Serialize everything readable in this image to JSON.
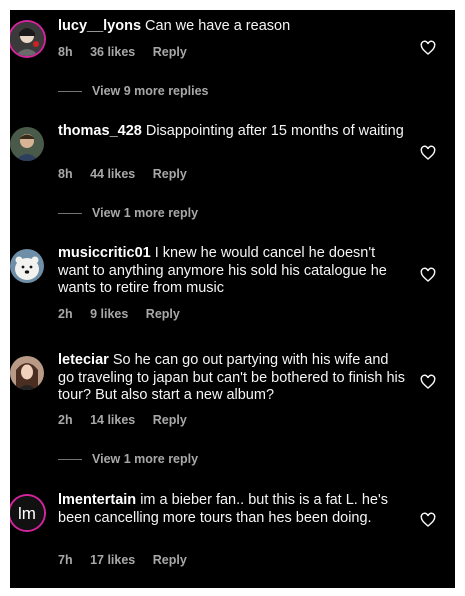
{
  "comments": [
    {
      "username": "lucy__lyons",
      "text": "Can we have a reason",
      "time": "8h",
      "likes": "36 likes",
      "reply": "Reply",
      "avatar": "avatar-photo"
    },
    {
      "username": "thomas_428",
      "text": "Disappointing after 15 months of waiting",
      "time": "8h",
      "likes": "44 likes",
      "reply": "Reply",
      "avatar": "avatar-photo"
    },
    {
      "username": "musiccritic01",
      "text": "I knew he would cancel he doesn't want to anything anymore his sold his catalogue he wants to retire from music",
      "time": "2h",
      "likes": "9 likes",
      "reply": "Reply",
      "avatar": "polar-bear-photo"
    },
    {
      "username": "leteciar",
      "text": "So he can go out partying with his wife and go traveling to japan but can't be bothered to finish his tour? But also start a new album?",
      "time": "2h",
      "likes": "14 likes",
      "reply": "Reply",
      "avatar": "avatar-photo"
    },
    {
      "username": "lmentertain",
      "text": "im a bieber fan.. but this is a fat L. he's been cancelling more tours than hes been doing.",
      "time": "7h",
      "likes": "17 likes",
      "reply": "Reply",
      "avatar": "lm-logo"
    }
  ],
  "view_more": [
    "View 9 more replies",
    "View 1 more reply",
    "View 1 more reply"
  ],
  "logo_text": "lm",
  "colors": {
    "background": "#000000",
    "text": "#f5f5f5",
    "secondary_text": "#a8a8a8",
    "story_ring": "#d6249f"
  },
  "icons": {
    "like": "heart-outline-icon"
  }
}
